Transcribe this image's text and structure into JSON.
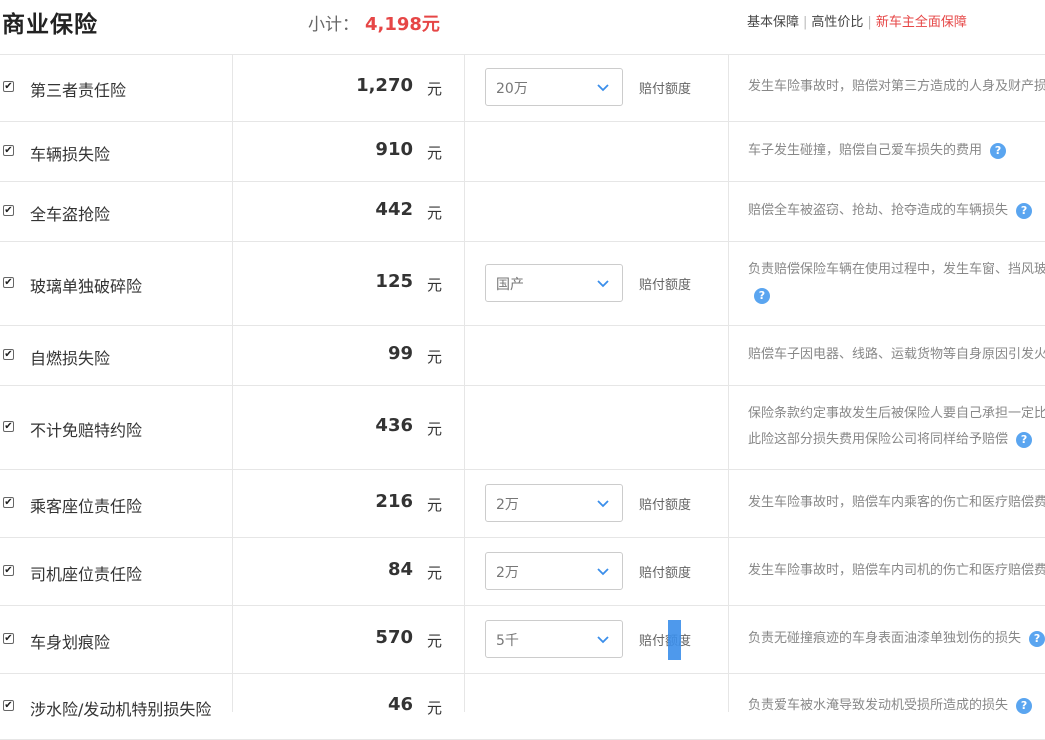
{
  "header": {
    "title": "商业保险",
    "subtotal_label": "小计：",
    "subtotal_value": "4,198元",
    "plans": [
      "基本保障",
      "高性价比",
      "新车主全面保障"
    ]
  },
  "unit": "元",
  "checkmark": "✔",
  "help_glyph": "?",
  "rows": [
    {
      "name": "第三者责任险",
      "price": "1,270",
      "select": "20万",
      "note": "赔付额度",
      "desc": [
        "发生车险事故时，赔偿对第三方造成的人身及财产损失"
      ]
    },
    {
      "name": "车辆损失险",
      "price": "910",
      "desc": [
        "车子发生碰撞，赔偿自己爱车损失的费用"
      ]
    },
    {
      "name": "全车盗抢险",
      "price": "442",
      "desc": [
        "赔偿全车被盗窃、抢劫、抢夺造成的车辆损失"
      ]
    },
    {
      "name": "玻璃单独破碎险",
      "price": "125",
      "select": "国产",
      "note": "赔付额度",
      "desc": [
        "负责赔偿保险车辆在使用过程中，发生车窗、挡风玻璃单独破碎的损失"
      ]
    },
    {
      "name": "自燃损失险",
      "price": "99",
      "desc": [
        "赔偿车子因电器、线路、运载货物等自身原因引发火灾的损失"
      ]
    },
    {
      "name": "不计免赔特约险",
      "price": "436",
      "desc": [
        "保险条款约定事故发生后被保险人要自己承担一定比例的损失，",
        "此险这部分损失费用保险公司将同样给予赔偿"
      ]
    },
    {
      "name": "乘客座位责任险",
      "price": "216",
      "select": "2万",
      "note": "赔付额度",
      "desc": [
        "发生车险事故时，赔偿车内乘客的伤亡和医疗赔偿费用"
      ]
    },
    {
      "name": "司机座位责任险",
      "price": "84",
      "select": "2万",
      "note": "赔付额度",
      "desc": [
        "发生车险事故时，赔偿车内司机的伤亡和医疗赔偿费用"
      ]
    },
    {
      "name": "车身划痕险",
      "price": "570",
      "select": "5千",
      "note": "赔付额度",
      "desc": [
        "负责无碰撞痕迹的车身表面油漆单独划伤的损失"
      ]
    },
    {
      "name": "涉水险/发动机特别损失险",
      "price": "46",
      "desc": [
        "负责爱车被水淹导致发动机受损所造成的损失"
      ]
    }
  ],
  "colors": {
    "accent": "#e64646",
    "help": "#5aa5f0",
    "selection": "#3b8eea"
  }
}
